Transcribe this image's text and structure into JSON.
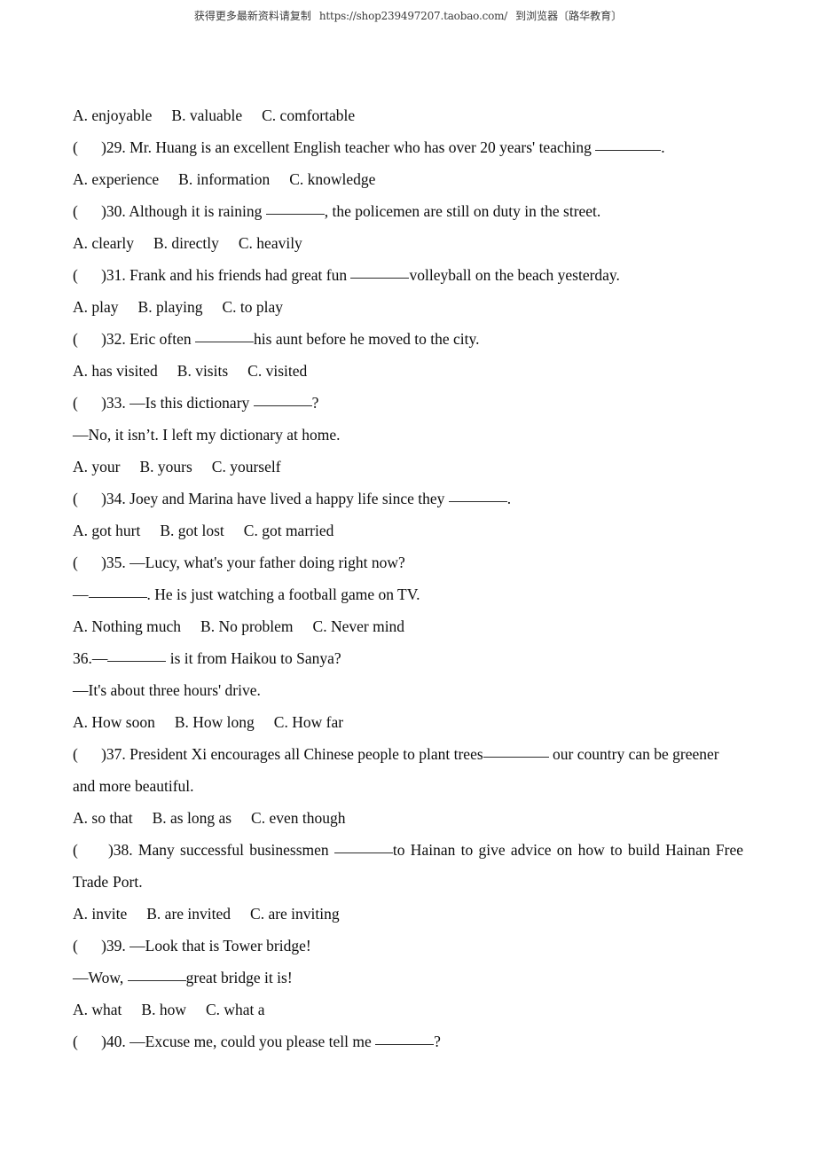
{
  "header": {
    "cn_prefix": "获得更多最新资料请复制",
    "url": "https://shop239497207.taobao.com/",
    "cn_suffix": "到浏览器〔路华教育〕"
  },
  "document": {
    "lines": [
      {
        "id": "options-28",
        "kind": "options",
        "a": "A. enjoyable",
        "b": "B. valuable",
        "c": "C. comfortable"
      },
      {
        "id": "question-29",
        "kind": "question",
        "bracket": "(      )",
        "number": "29.",
        "text_before": " Mr. Huang is an excellent English teacher who has over 20 years' teaching ",
        "text_after": "."
      },
      {
        "id": "options-29",
        "kind": "options",
        "a": "A. experience",
        "b": "B. information",
        "c": "C. knowledge"
      },
      {
        "id": "question-30",
        "kind": "question",
        "bracket": "(      )",
        "number": "30.",
        "text_before": " Although it is raining ",
        "text_after": ", the policemen are still on duty in the street."
      },
      {
        "id": "options-30",
        "kind": "options",
        "a": "A. clearly",
        "b": "B. directly",
        "c": "C. heavily"
      },
      {
        "id": "question-31",
        "kind": "question",
        "bracket": "(      )",
        "number": "31.",
        "text_before": " Frank and his friends had great fun ",
        "text_after": "volleyball on the beach yesterday."
      },
      {
        "id": "options-31",
        "kind": "options",
        "a": "A. play",
        "b": "B. playing",
        "c": "C. to play"
      },
      {
        "id": "question-32",
        "kind": "question",
        "bracket": "(      )",
        "number": "32.",
        "text_before": " Eric often ",
        "text_after": "his aunt before he moved to the city."
      },
      {
        "id": "options-32",
        "kind": "options",
        "a": "A. has visited",
        "b": "B. visits",
        "c": "C. visited"
      },
      {
        "id": "question-33",
        "kind": "question",
        "bracket": "(      )",
        "number": "33.",
        "text_before": " —Is this dictionary ",
        "text_after": "?"
      },
      {
        "id": "reply-33",
        "kind": "plain",
        "text": "—No, it isn’t. I left my dictionary at home."
      },
      {
        "id": "options-33",
        "kind": "options",
        "a": "A. your",
        "b": "B. yours",
        "c": "C. yourself"
      },
      {
        "id": "question-34",
        "kind": "question",
        "bracket": "(      )",
        "number": "34.",
        "text_before": " Joey and Marina have lived a happy life since they ",
        "text_after": "."
      },
      {
        "id": "options-34",
        "kind": "options",
        "a": "A. got hurt",
        "b": "B. got lost",
        "c": "C. got married"
      },
      {
        "id": "question-35",
        "kind": "question-noblank",
        "bracket": "(      )",
        "number": "35.",
        "text_before": " —Lucy, what's your father doing right now?"
      },
      {
        "id": "reply-35",
        "kind": "plain-blank",
        "text_before": "—",
        "text_after": ". He is just watching a football game on TV."
      },
      {
        "id": "options-35",
        "kind": "options",
        "a": "A. Nothing much",
        "b": "B. No problem",
        "c": "C. Never mind"
      },
      {
        "id": "question-36",
        "kind": "question-nobracket",
        "number": "36.",
        "text_before": "—",
        "text_after": " is it from Haikou to Sanya?"
      },
      {
        "id": "reply-36",
        "kind": "plain",
        "text": "—It's about three hours' drive."
      },
      {
        "id": "options-36",
        "kind": "options",
        "a": "A. How soon",
        "b": "B. How long",
        "c": "C. How far"
      },
      {
        "id": "question-37",
        "kind": "question-wrap",
        "bracket": "(      )",
        "number": "37.",
        "text_before": " President Xi encourages all Chinese people to plant trees",
        "text_after": " our country can be greener and more beautiful."
      },
      {
        "id": "options-37",
        "kind": "options",
        "a": "A. so that",
        "b": "B. as long as",
        "c": "C. even though"
      },
      {
        "id": "question-38",
        "kind": "question-wrap-justify",
        "bracket": "(       )",
        "number": "38.",
        "text_before": " Many successful businessmen ",
        "text_after": "to Hainan to give advice on how to build Hainan Free Trade Port."
      },
      {
        "id": "options-38",
        "kind": "options",
        "a": "A. invite",
        "b": "B. are invited",
        "c": "C. are inviting"
      },
      {
        "id": "question-39",
        "kind": "question-noblank",
        "bracket": "(      )",
        "number": "39.",
        "text_before": " —Look that is Tower bridge!"
      },
      {
        "id": "reply-39",
        "kind": "plain-blank",
        "text_before": "—Wow, ",
        "text_after": "great bridge it is!"
      },
      {
        "id": "options-39",
        "kind": "options",
        "a": "A. what",
        "b": "B. how",
        "c": "C. what a"
      },
      {
        "id": "question-40",
        "kind": "question",
        "bracket": "(      )",
        "number": "40.",
        "text_before": " —Excuse me, could you please tell me ",
        "text_after": "?"
      }
    ]
  }
}
